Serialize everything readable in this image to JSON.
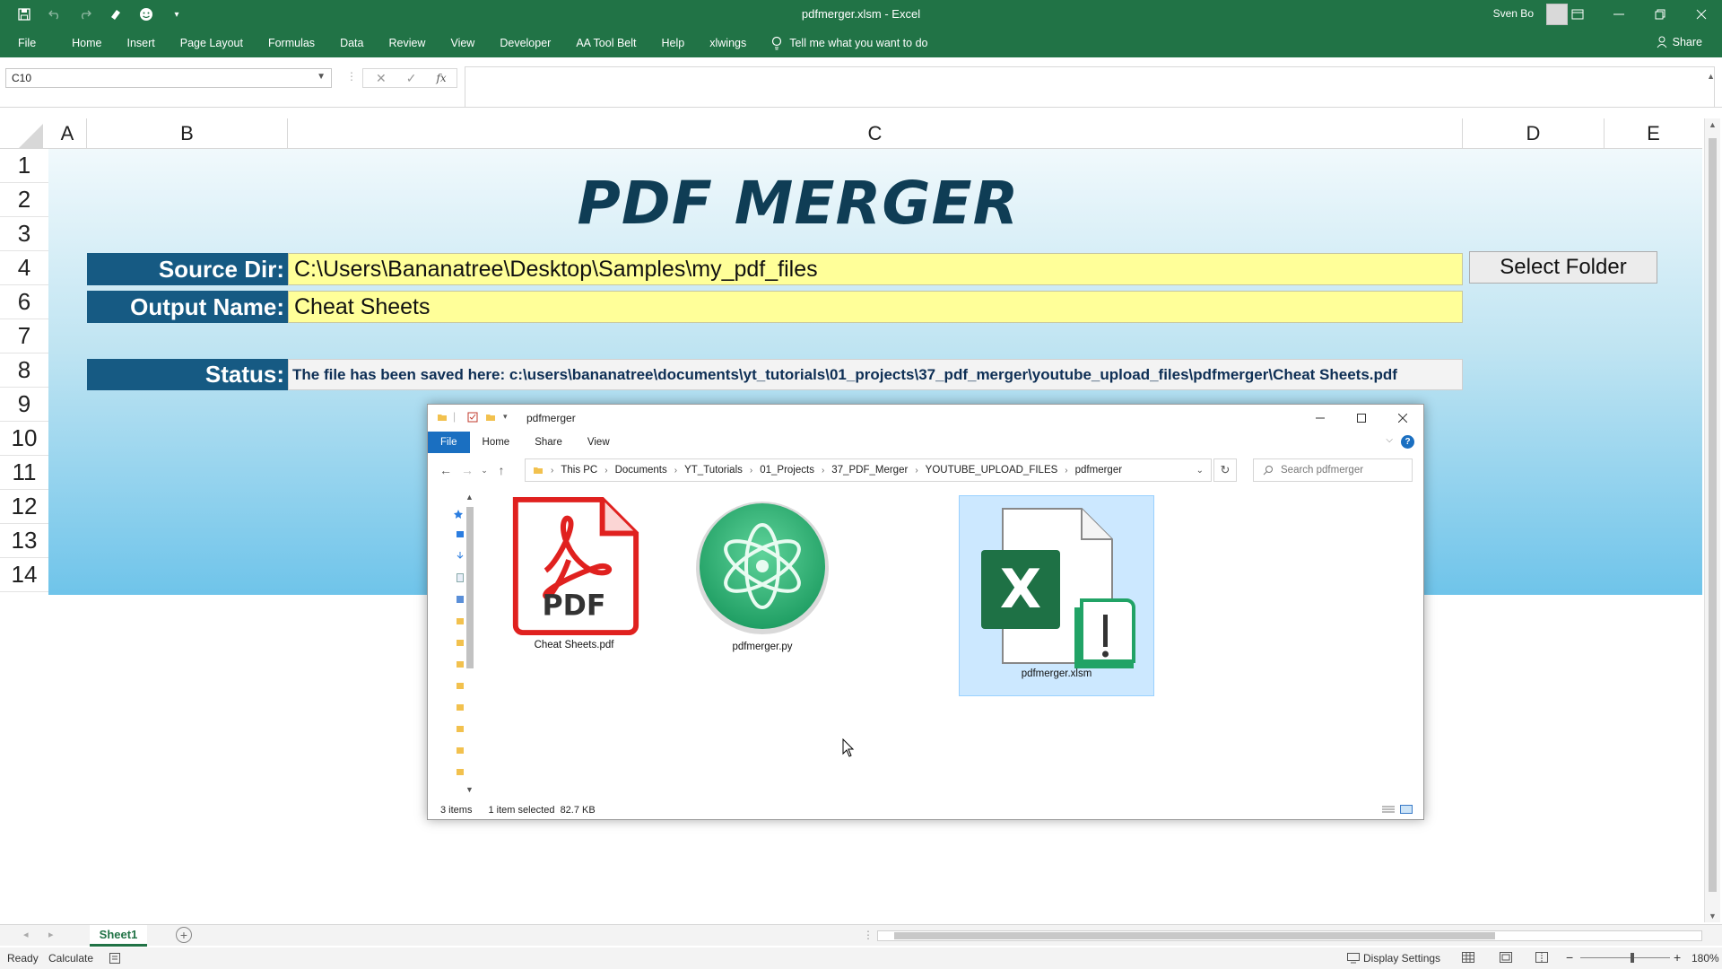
{
  "window": {
    "title": "pdfmerger.xlsm - Excel",
    "user": "Sven Bo"
  },
  "ribbon": {
    "tabs": [
      "File",
      "Home",
      "Insert",
      "Page Layout",
      "Formulas",
      "Data",
      "Review",
      "View",
      "Developer",
      "AA Tool Belt",
      "Help",
      "xlwings"
    ],
    "tell_me": "Tell me what you want to do",
    "share": "Share"
  },
  "formula_bar": {
    "name_box": "C10",
    "fx": "fx",
    "content": ""
  },
  "columns": [
    "A",
    "B",
    "C",
    "D",
    "E"
  ],
  "rows": [
    "1",
    "2",
    "3",
    "4",
    "6",
    "7",
    "8",
    "9",
    "10",
    "11",
    "12",
    "13",
    "14"
  ],
  "sheet": {
    "title": "PDF MERGER",
    "source_label": "Source Dir:",
    "source_value": "C:\\Users\\Bananatree\\Desktop\\Samples\\my_pdf_files",
    "output_label": "Output Name:",
    "output_value": "Cheat Sheets",
    "status_label": "Status:",
    "status_value": "The file has been saved here: c:\\users\\bananatree\\documents\\yt_tutorials\\01_projects\\37_pdf_merger\\youtube_upload_files\\pdfmerger\\Cheat Sheets.pdf",
    "select_folder": "Select Folder"
  },
  "explorer": {
    "title": "pdfmerger",
    "tabs": [
      "File",
      "Home",
      "Share",
      "View"
    ],
    "help": "?",
    "path": [
      "This PC",
      "Documents",
      "YT_Tutorials",
      "01_Projects",
      "37_PDF_Merger",
      "YOUTUBE_UPLOAD_FILES",
      "pdfmerger"
    ],
    "search_placeholder": "Search pdfmerger",
    "files": [
      {
        "name": "Cheat Sheets.pdf",
        "icon": "pdf-file-icon",
        "selected": false
      },
      {
        "name": "pdfmerger.py",
        "icon": "atom-python-icon",
        "selected": false
      },
      {
        "name": "pdfmerger.xlsm",
        "icon": "excel-macro-file-icon",
        "selected": true
      }
    ],
    "status_items": "3 items",
    "status_selected": "1 item selected  82.7 KB",
    "pdf_icon_text": "PDF",
    "excel_icon_text": "X"
  },
  "bottom": {
    "sheet_tab": "Sheet1",
    "add_sheet": "+",
    "status_ready": "Ready",
    "status_calculate": "Calculate",
    "display_settings": "Display Settings",
    "zoom": "180%"
  },
  "colors": {
    "excel_green": "#217346",
    "label_blue": "#165a83",
    "input_yellow": "#ffff99",
    "explorer_file_tab": "#1a6fc1",
    "selection": "#cce8ff"
  }
}
